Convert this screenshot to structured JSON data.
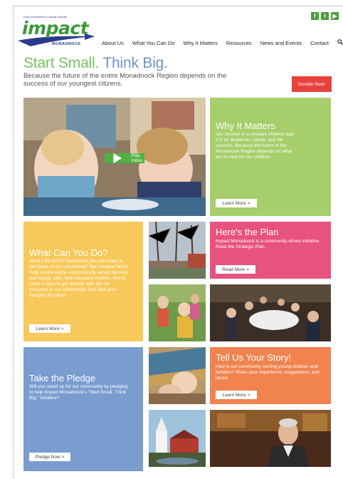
{
  "header": {
    "logo_tagline": "Early Investment | Lasting Change",
    "logo_word": "impact",
    "logo_sub": "MONADNOCK",
    "social": [
      {
        "icon": "facebook-icon",
        "glyph": "f"
      },
      {
        "icon": "twitter-icon",
        "glyph": "t"
      },
      {
        "icon": "youtube-icon",
        "glyph": "▶"
      }
    ],
    "nav": [
      "About Us",
      "What You Can Do",
      "Why It Matters",
      "Resources",
      "News and Events",
      "Contact"
    ],
    "search_glyph": "🔍"
  },
  "hero": {
    "title_green": "Start Small.",
    "title_blue": "Think Big.",
    "subtitle": "Because the future of the entire Monadnock Region depends on the success of our youngest citizens.",
    "donate_label": "Donate Now!"
  },
  "video": {
    "play_label": "Play Video"
  },
  "why": {
    "title": "Why It Matters",
    "body": "Our mission is to prepare children age 0-5 for academic, career, and life success. Because the future of the Monadnock Region depends on what we do now for our children.",
    "button": "Learn More >"
  },
  "what": {
    "title": "What Can You Do?",
    "body": "What's the BEST investment you can make in the future of our community? Get involved NOW. Help create stable, economically secure families and happy, safe, well-educated children. We've made it easy to get started, with tips for everyone in our community! Just click your category for ideas.",
    "button": "Learn More >"
  },
  "plan": {
    "title": "Here's the Plan",
    "body": "Impact Monadnock is a community-driven initiative. Read the Strategic Plan.",
    "button": "Read More >"
  },
  "pledge": {
    "title": "Take the Pledge",
    "body": "Will you stand up for our community by pledging to help Impact Monadnock's \"Start Small. Think Big.\" initiative?",
    "button": "Pledge Now >"
  },
  "story": {
    "title": "Tell Us Your Story!",
    "body": "How is our community serving young children and families? Share your experience, suggestions, and ideas!",
    "button": "Learn More >"
  },
  "colors": {
    "green": "#a6cf6b",
    "yellow": "#f7c95a",
    "pink": "#e8527e",
    "blue": "#7a9ccf",
    "orange": "#f0834e",
    "donate": "#e8423c"
  }
}
